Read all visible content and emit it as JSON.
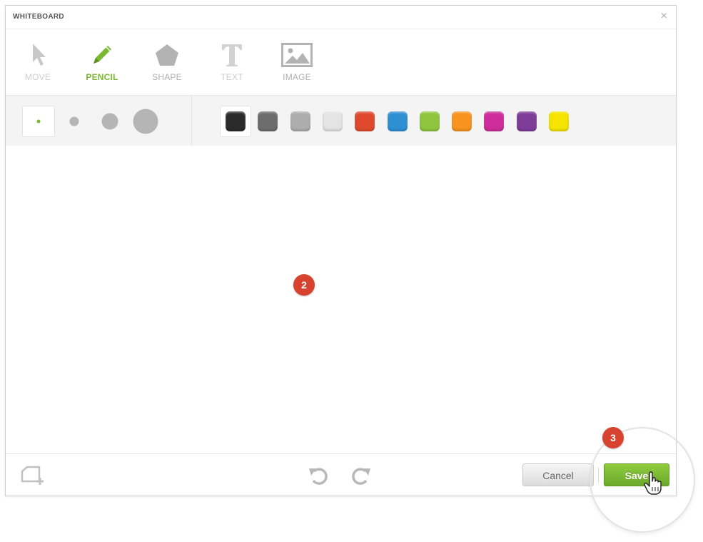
{
  "window": {
    "title": "WHITEBOARD",
    "close_glyph": "×"
  },
  "toolbar": {
    "tools": [
      {
        "label": "MOVE",
        "icon": "pointer-arrow-icon",
        "state": "disabled"
      },
      {
        "label": "PENCIL",
        "icon": "pencil-icon",
        "state": "active"
      },
      {
        "label": "SHAPE",
        "icon": "pentagon-icon",
        "state": "normal"
      },
      {
        "label": "TEXT",
        "icon": "text-t-icon",
        "state": "disabled"
      },
      {
        "label": "IMAGE",
        "icon": "image-icon",
        "state": "normal"
      }
    ]
  },
  "brush_sizes": {
    "options": [
      "xs",
      "sm",
      "md",
      "lg"
    ],
    "selected_index": 0
  },
  "colors": {
    "selected_index": 0,
    "swatches": [
      "#2b2b2b",
      "#6d6d6d",
      "#adadad",
      "#e4e4e4",
      "#df4a2e",
      "#2f8fd3",
      "#8ec63f",
      "#f7931e",
      "#cc2d9a",
      "#7d3c98",
      "#f5e400"
    ],
    "accent": "#7cb932"
  },
  "markers": {
    "canvas_step": "2",
    "save_step": "3"
  },
  "footer": {
    "new_board_icon": "new-board-icon",
    "undo_icon": "undo-icon",
    "redo_icon": "redo-icon",
    "cancel_label": "Cancel",
    "save_label": "Save"
  }
}
